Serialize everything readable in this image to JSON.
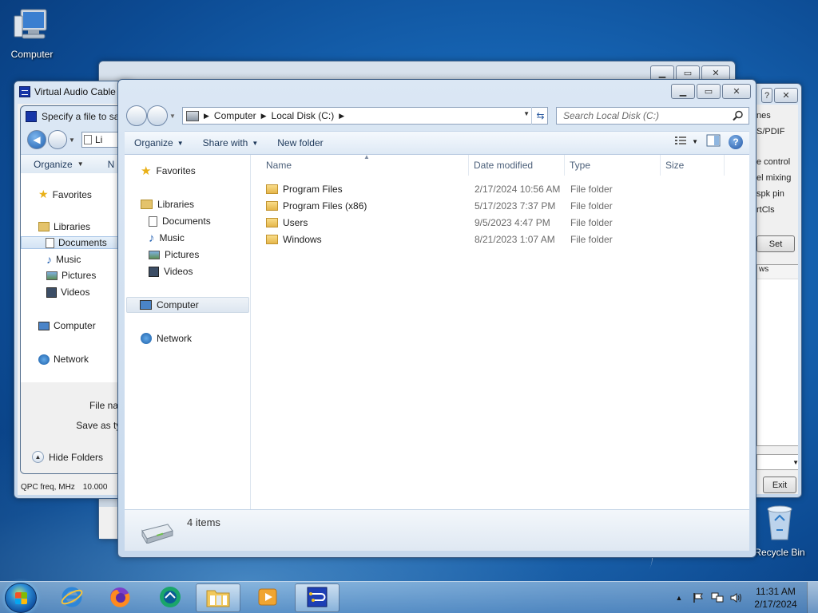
{
  "desktop": {
    "icons": [
      {
        "label": "Computer"
      },
      {
        "label": "Recycle Bin"
      }
    ]
  },
  "vac_window": {
    "title": "Virtual Audio Cable",
    "footer_label": "QPC freq, MHz",
    "footer_value": "10.000"
  },
  "save_dialog": {
    "title": "Specify a file to save",
    "address_value": "Li",
    "toolbar": {
      "organize": "Organize",
      "new": "N"
    },
    "nav": {
      "favorites": "Favorites",
      "libraries": "Libraries",
      "documents": "Documents",
      "music": "Music",
      "pictures": "Pictures",
      "videos": "Videos",
      "computer": "Computer",
      "network": "Network"
    },
    "file_name_label": "File name:",
    "save_as_type_label": "Save as type:",
    "hide_folders": "Hide Folders"
  },
  "vac_right": {
    "texts": [
      "nes",
      "S/PDIF",
      "e control",
      "el mixing",
      "spk pin",
      "rtCls"
    ],
    "set_button": "Set",
    "list_header": "ws",
    "exit_button": "Exit"
  },
  "explorer": {
    "breadcrumb": [
      "Computer",
      "Local Disk (C:)"
    ],
    "search_placeholder": "Search Local Disk (C:)",
    "toolbar": {
      "organize": "Organize",
      "share_with": "Share with",
      "new_folder": "New folder"
    },
    "nav": {
      "favorites": "Favorites",
      "libraries": "Libraries",
      "documents": "Documents",
      "music": "Music",
      "pictures": "Pictures",
      "videos": "Videos",
      "computer": "Computer",
      "network": "Network"
    },
    "columns": {
      "name": "Name",
      "date_modified": "Date modified",
      "type": "Type",
      "size": "Size"
    },
    "rows": [
      {
        "name": "Program Files",
        "date": "2/17/2024 10:56 AM",
        "type": "File folder"
      },
      {
        "name": "Program Files (x86)",
        "date": "5/17/2023 7:37 PM",
        "type": "File folder"
      },
      {
        "name": "Users",
        "date": "9/5/2023 4:47 PM",
        "type": "File folder"
      },
      {
        "name": "Windows",
        "date": "8/21/2023 1:07 AM",
        "type": "File folder"
      }
    ],
    "status": "4 items"
  },
  "taskbar": {
    "clock_time": "11:31 AM",
    "clock_date": "2/17/2024"
  }
}
